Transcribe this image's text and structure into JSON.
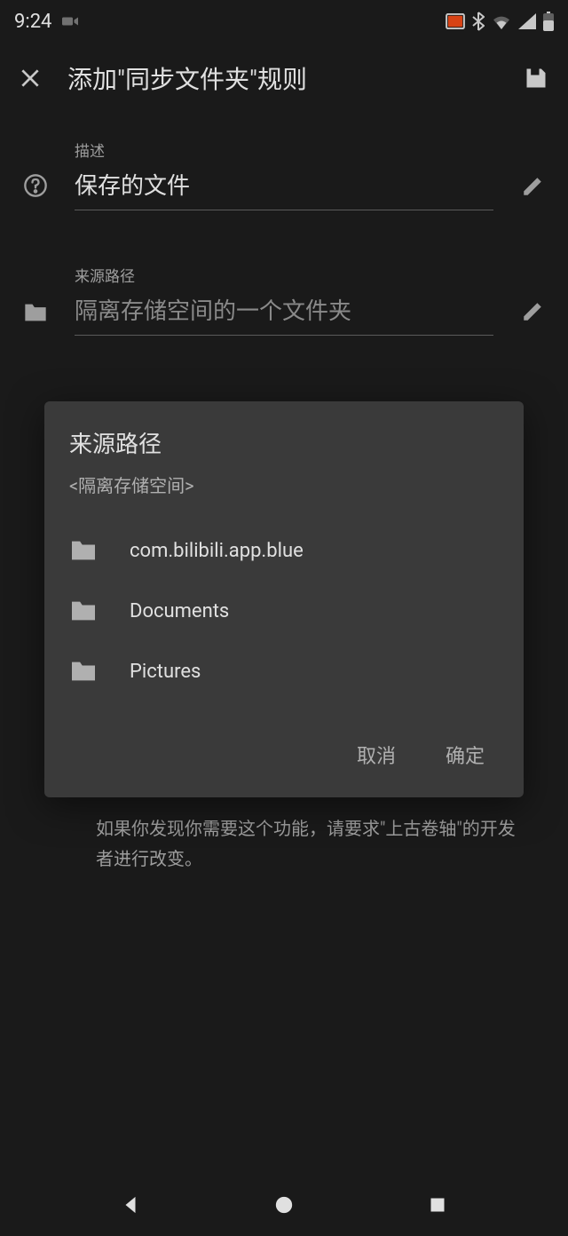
{
  "status": {
    "time": "9:24"
  },
  "appbar": {
    "title": "添加\"同步文件夹\"规则"
  },
  "fields": {
    "description": {
      "label": "描述",
      "value": "保存的文件"
    },
    "source": {
      "label": "来源路径",
      "placeholder": "隔离存储空间的一个文件夹"
    }
  },
  "behind_hint": "如果你发现你需要这个功能，请要求\"上古卷轴\"的开发者进行改变。",
  "dialog": {
    "title": "来源路径",
    "subtitle": "<隔离存储空间>",
    "folders": [
      {
        "name": "com.bilibili.app.blue"
      },
      {
        "name": "Documents"
      },
      {
        "name": "Pictures"
      }
    ],
    "cancel": "取消",
    "confirm": "确定"
  }
}
